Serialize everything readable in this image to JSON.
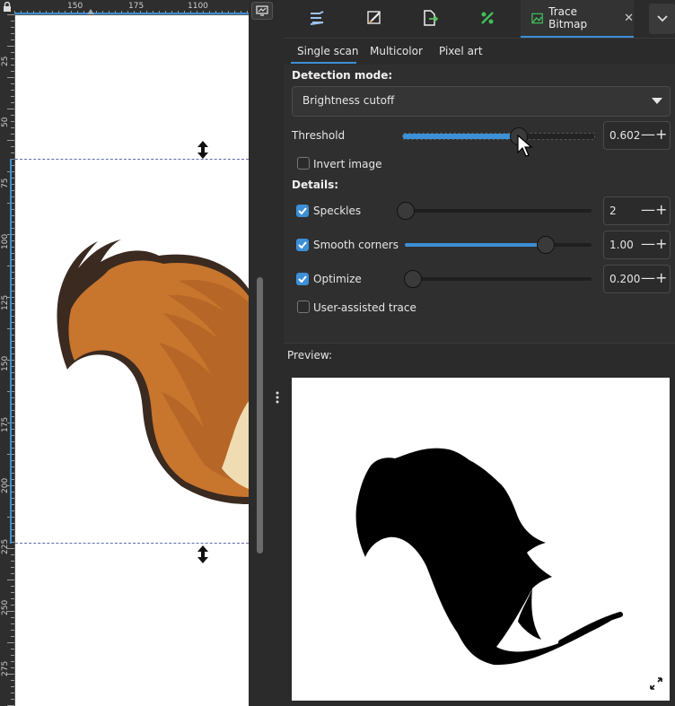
{
  "ruler": {
    "top_labels": [
      "150",
      "175",
      "1100"
    ],
    "left_labels": [
      "25",
      "50",
      "75",
      "100",
      "125",
      "150",
      "175",
      "200",
      "225",
      "250",
      "275"
    ]
  },
  "dock": {
    "tabs": [
      "align-distribute",
      "fill-stroke",
      "export",
      "trace-bitmap"
    ],
    "active_tab_label": "Trace Bitmap",
    "close_glyph": "✕"
  },
  "modes": {
    "tabs": [
      "Single scan",
      "Multicolor",
      "Pixel art"
    ],
    "active": "Single scan"
  },
  "settings": {
    "detection_mode_label": "Detection mode:",
    "detection_mode_value": "Brightness cutoff",
    "threshold_label": "Threshold",
    "threshold_value": "0.602",
    "threshold_fraction": 0.602,
    "invert_label": "Invert image",
    "invert_checked": false,
    "details_label": "Details:",
    "speckles_label": "Speckles",
    "speckles_checked": true,
    "speckles_value": "2",
    "speckles_fraction": 0.0,
    "smooth_label": "Smooth corners",
    "smooth_checked": true,
    "smooth_value": "1.00",
    "smooth_fraction": 0.75,
    "optimize_label": "Optimize",
    "optimize_checked": true,
    "optimize_value": "0.200",
    "optimize_fraction": 0.0,
    "user_assisted_label": "User-assisted trace",
    "user_assisted_checked": false,
    "minus_glyph": "—",
    "plus_glyph": "+"
  },
  "preview": {
    "label": "Preview:"
  },
  "colors": {
    "accent": "#3d8fd6",
    "panel_bg": "#2b2b2b",
    "tail_orange": "#c8752e",
    "tail_dark": "#3a2a20"
  }
}
